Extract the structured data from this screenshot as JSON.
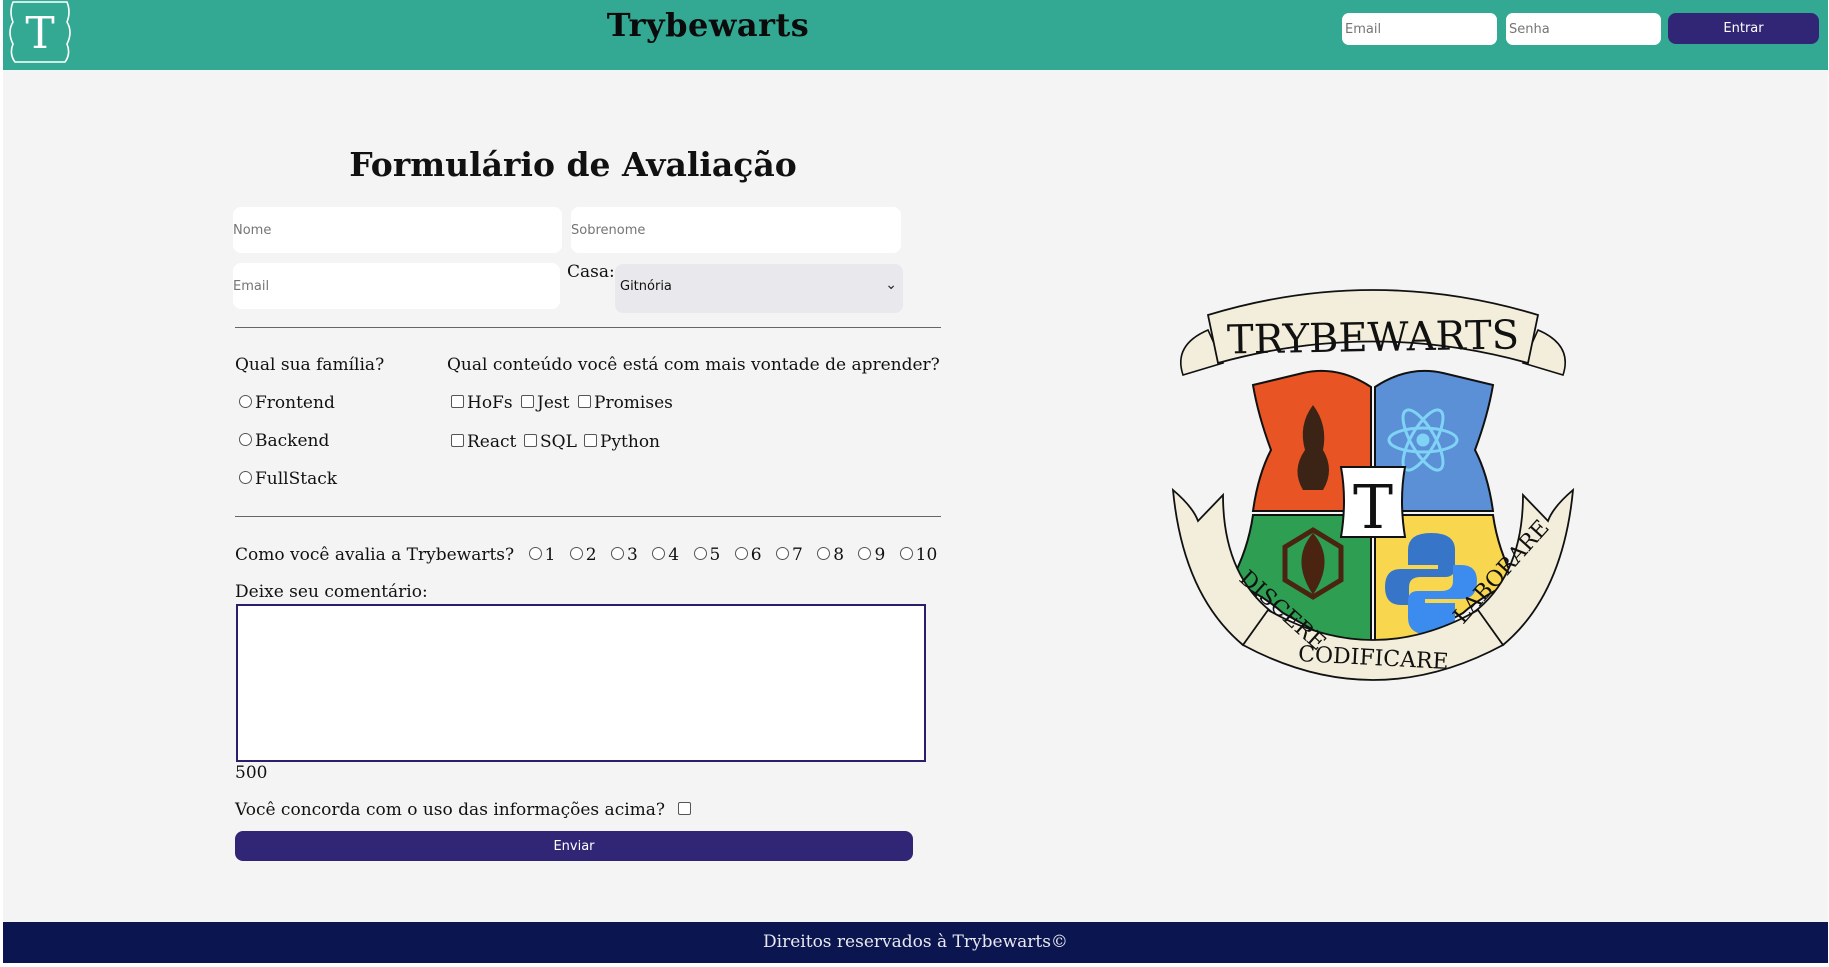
{
  "header": {
    "logo_letter": "T",
    "title": "Trybewarts",
    "email_placeholder": "Email",
    "password_placeholder": "Senha",
    "login_button": "Entrar"
  },
  "form": {
    "title": "Formulário de Avaliação",
    "name_placeholder": "Nome",
    "lastname_placeholder": "Sobrenome",
    "email_placeholder": "Email",
    "house_label": "Casa:",
    "house_selected": "Gitnória",
    "family_question": "Qual sua família?",
    "families": [
      "Frontend",
      "Backend",
      "FullStack"
    ],
    "content_question": "Qual conteúdo você está com mais vontade de aprender?",
    "contents": [
      "HoFs",
      "Jest",
      "Promises",
      "React",
      "SQL",
      "Python"
    ],
    "rating_question": "Como você avalia a Trybewarts?",
    "ratings": [
      "1",
      "2",
      "3",
      "4",
      "5",
      "6",
      "7",
      "8",
      "9",
      "10"
    ],
    "comment_label": "Deixe seu comentário:",
    "char_counter": "500",
    "agreement_label": "Você concorda com o uso das informações acima?",
    "submit_button": "Enviar"
  },
  "crest": {
    "banner_title": "TRYBEWARTS",
    "center_letter": "T",
    "motto_left": "DISCERE",
    "motto_center": "CODIFICARE",
    "motto_right": "LABORARE",
    "colors": {
      "top_left": "#e85424",
      "top_right": "#5b8fd6",
      "bottom_left": "#2e9e53",
      "bottom_right": "#f8d64e",
      "scroll": "#f3eedb"
    }
  },
  "footer": {
    "text": "Direitos reservados à Trybewarts©"
  },
  "colors": {
    "header_bg": "#33a993",
    "button_bg": "#312675",
    "footer_bg": "#0b1650",
    "page_bg": "#f4f4f4"
  }
}
